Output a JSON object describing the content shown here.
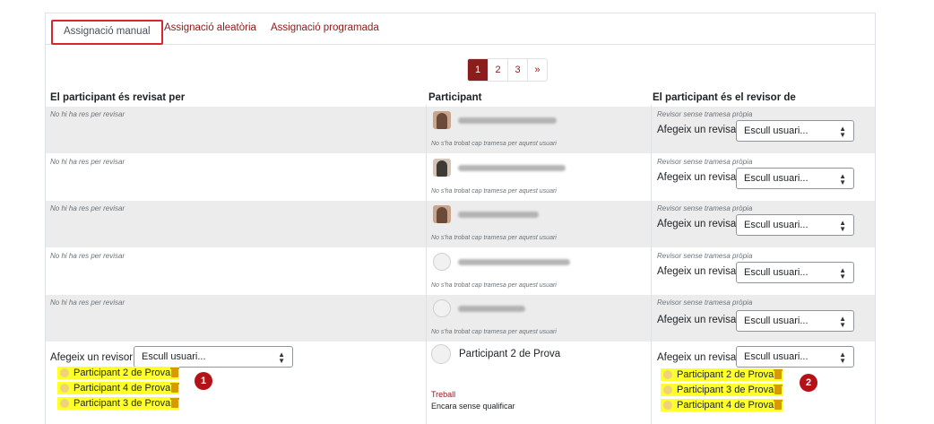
{
  "tabs": [
    {
      "label": "Assignació manual"
    },
    {
      "label": "Assignació aleatòria"
    },
    {
      "label": "Assignació programada"
    }
  ],
  "pagination": {
    "pages": [
      "1",
      "2",
      "3"
    ],
    "current": "1",
    "next": "»"
  },
  "columns": {
    "reviewed_by": "El participant és revisat per",
    "participant": "Participant",
    "reviewer_of": "El participant és el revisor de"
  },
  "texts": {
    "nothing_to_review": "No hi ha res per revisar",
    "no_submission": "No s'ha trobat cap tramesa per aquest usuari",
    "reviewer_without_submission": "Revisor sense tramesa pròpia",
    "add_reviewee": "Afegeix un revisat",
    "add_reviewer": "Afegeix un revisor",
    "select_user": "Escull usuari..."
  },
  "last_row": {
    "participant_name": "Participant 2 de Prova",
    "submission_link": "Treball",
    "grade_status": "Encara sense qualificar",
    "reviewers": [
      "Participant 2 de Prova",
      "Participant 4 de Prova",
      "Participant 3 de Prova"
    ],
    "reviewees": [
      "Participant 2 de Prova",
      "Participant 3 de Prova",
      "Participant 4 de Prova"
    ],
    "badge_left": "1",
    "badge_right": "2"
  },
  "colors": {
    "accent": "#8b1d1d",
    "highlight": "#ffff2a",
    "badge": "#b31217",
    "tab_outline": "#d9262c"
  },
  "icons": [
    "user-icon",
    "trash-icon",
    "select-caret-icon"
  ]
}
